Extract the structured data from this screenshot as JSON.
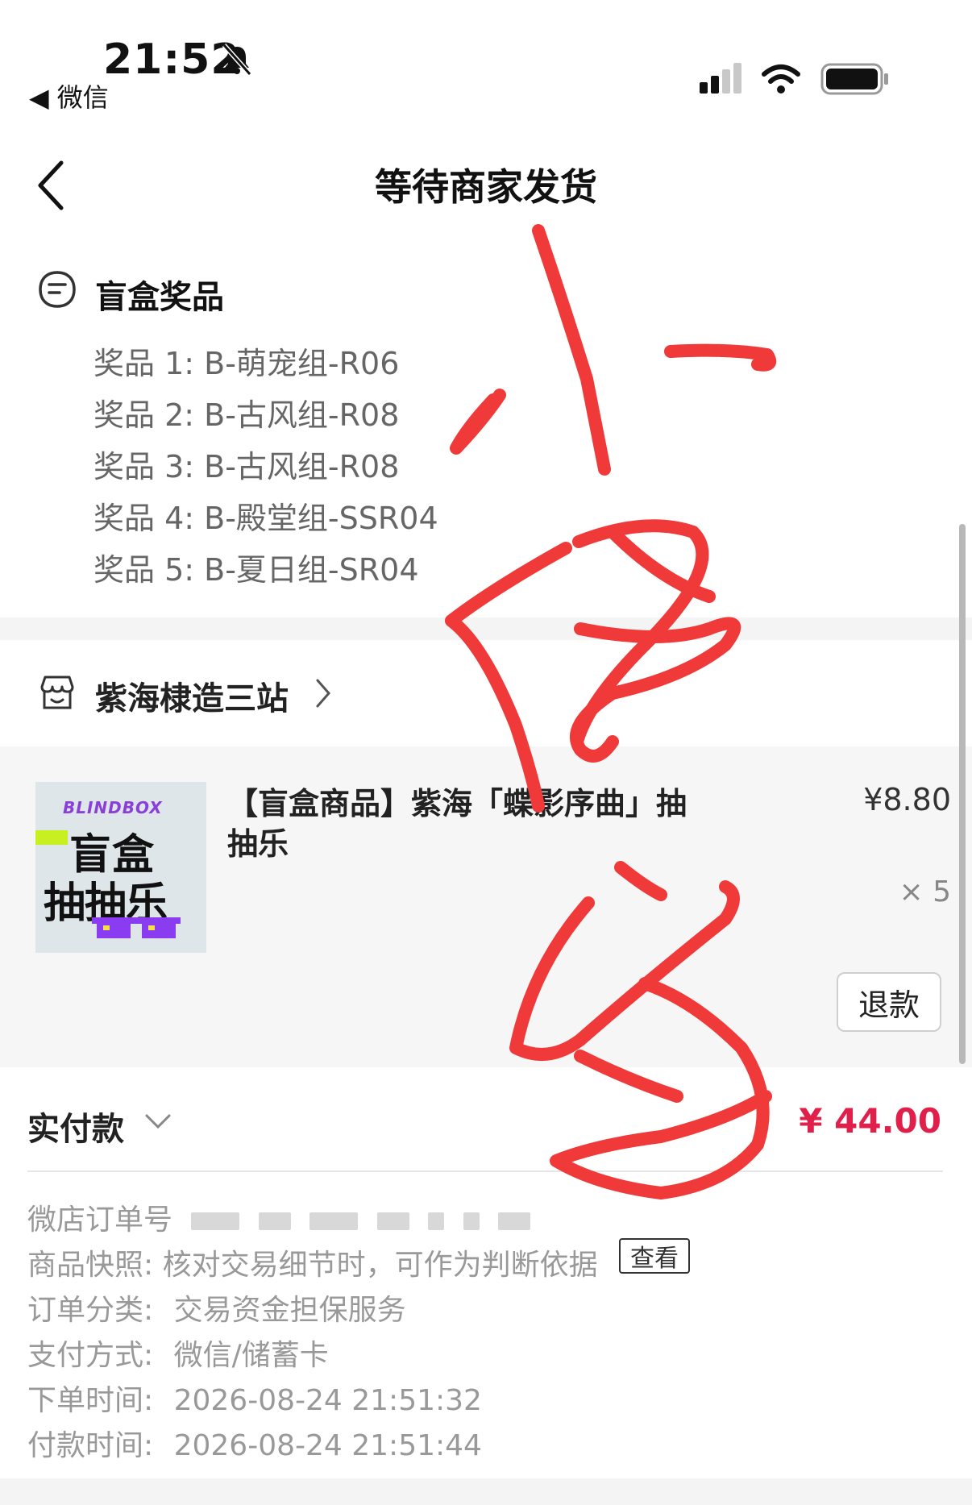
{
  "status_bar": {
    "time": "21:52",
    "back_app": "◀ 微信"
  },
  "nav": {
    "title": "等待商家发货"
  },
  "prizes": {
    "title": "盲盒奖品",
    "items": [
      "奖品 1: B-萌宠组-R06",
      "奖品 2: B-古风组-R08",
      "奖品 3: B-古风组-R08",
      "奖品 4: B-殿堂组-SSR04",
      "奖品 5: B-夏日组-SR04"
    ]
  },
  "store": {
    "name": "紫海棣造三站"
  },
  "product": {
    "thumb_tag": "BLINDBOX",
    "thumb_line1": "盲盒",
    "thumb_line2": "抽抽乐",
    "title": "【盲盒商品】紫海「蝶影序曲」抽抽乐",
    "price": "¥8.80",
    "quantity": "× 5",
    "refund_label": "退款"
  },
  "payment": {
    "label": "实付款",
    "amount": "¥ 44.00"
  },
  "order_info": {
    "order_no_label": "微店订单号",
    "snapshot_label": "商品快照:",
    "snapshot_text": "核对交易细节时，可作为判断依据",
    "snapshot_button": "查看",
    "category_label": "订单分类:",
    "category_value": "交易资金担保服务",
    "pay_method_label": "支付方式:",
    "pay_method_value": "微信/储蓄卡",
    "order_time_label": "下单时间:",
    "order_time_value": "2026-08-24 21:51:32",
    "pay_time_label": "付款时间:",
    "pay_time_value": "2026-08-24 21:51:44"
  },
  "colors": {
    "price_red": "#e0204a",
    "handwriting": "#f03a3a",
    "card_bg": "#f6f6f6"
  }
}
